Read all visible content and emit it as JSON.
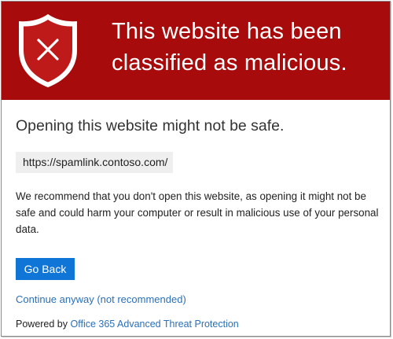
{
  "banner": {
    "title": "This website has been classified as malicious.",
    "background_color": "#a70b0b",
    "icon": "shield-x-icon"
  },
  "main": {
    "subtitle": "Opening this website might not be safe.",
    "url": "https://spamlink.contoso.com/",
    "description": "We recommend that you don't open this website, as opening it might not be safe and could harm your computer or result in malicious use of your personal data.",
    "go_back_label": "Go Back",
    "continue_label": "Continue anyway (not recommended)",
    "powered_prefix": "Powered by",
    "powered_link": "Office 365 Advanced Threat Protection"
  },
  "colors": {
    "accent": "#0f76d7",
    "link": "#2a6fb8",
    "url_background": "#efefef"
  }
}
